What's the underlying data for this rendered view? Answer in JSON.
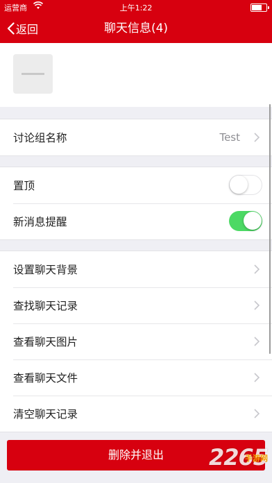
{
  "status_bar": {
    "carrier": "运营商",
    "time": "上午1:22"
  },
  "nav": {
    "back_label": "返回",
    "title": "聊天信息(4)"
  },
  "group_name": {
    "label": "讨论组名称",
    "value": "Test"
  },
  "toggles": [
    {
      "label": "置顶",
      "on": false
    },
    {
      "label": "新消息提醒",
      "on": true
    }
  ],
  "menu": [
    {
      "label": "设置聊天背景"
    },
    {
      "label": "查找聊天记录"
    },
    {
      "label": "查看聊天图片"
    },
    {
      "label": "查看聊天文件"
    },
    {
      "label": "清空聊天记录"
    }
  ],
  "delete_button": {
    "label": "删除并退出"
  },
  "watermark": {
    "text": "2265",
    "sub": "手游网"
  },
  "colors": {
    "brand_red": "#d7000f",
    "toggle_on": "#4cd964"
  }
}
